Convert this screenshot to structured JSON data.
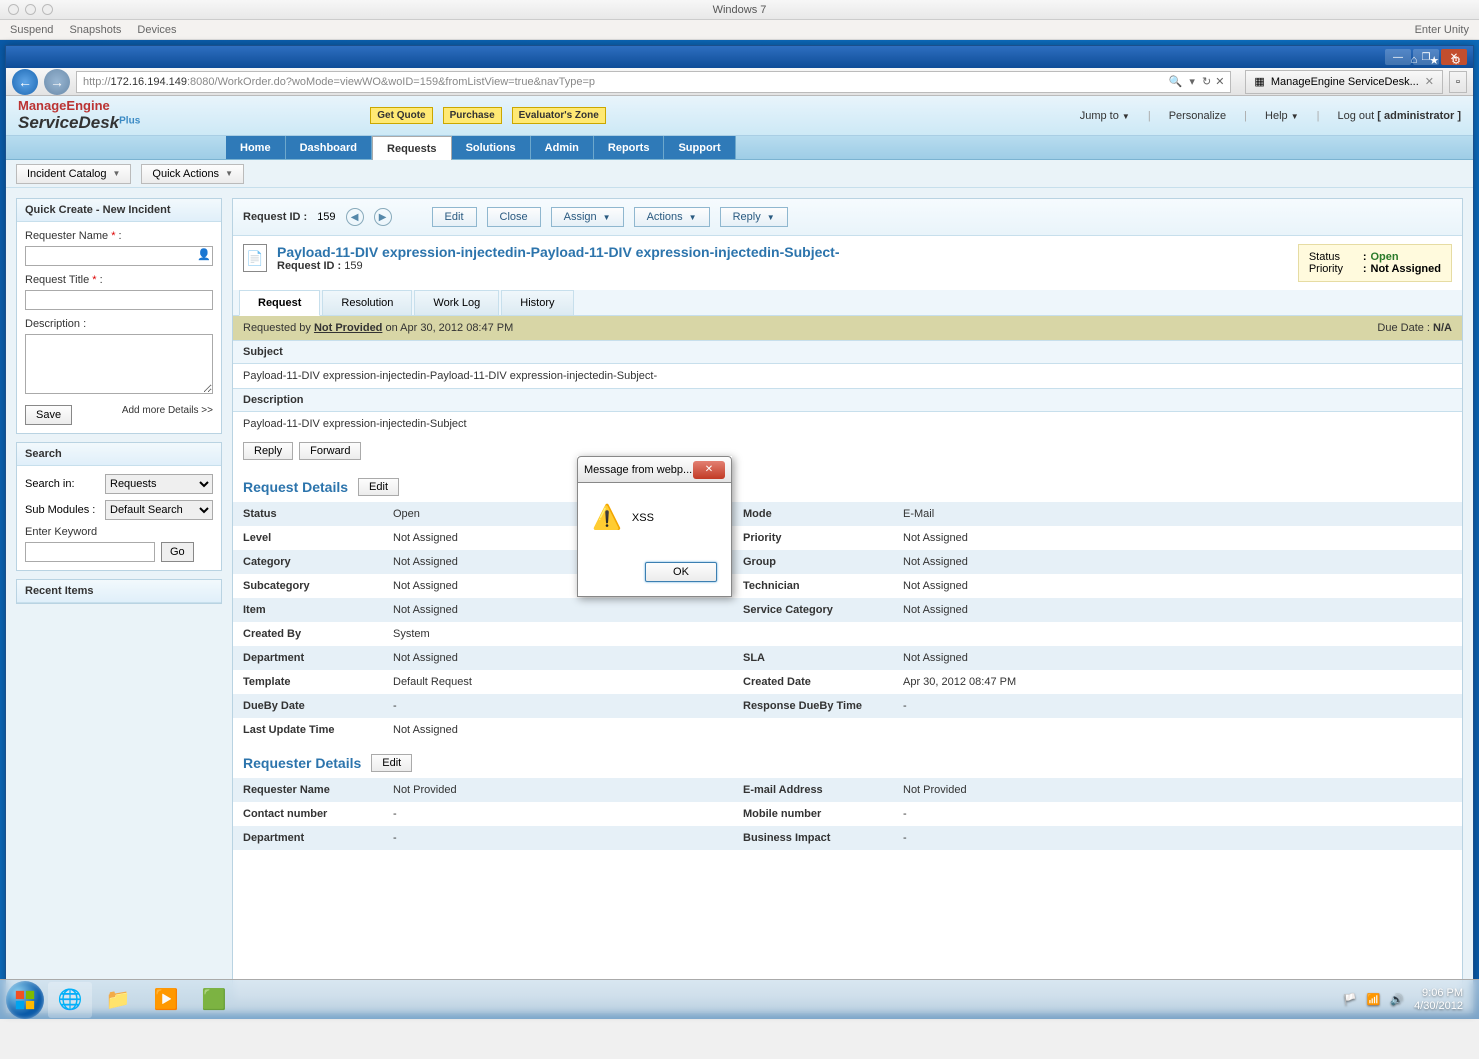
{
  "mac": {
    "title": "Windows 7",
    "menu": [
      "Suspend",
      "Snapshots",
      "Devices"
    ],
    "right": "Enter Unity"
  },
  "browser": {
    "url_prefix": "http://",
    "url_host": "172.16.194.149",
    "url_rest": ":8080/WorkOrder.do?woMode=viewWO&woID=159&fromListView=true&navType=p",
    "tab_title": "ManageEngine ServiceDesk..."
  },
  "header": {
    "logo_top": "ManageEngine",
    "logo_bottom": "ServiceDesk",
    "logo_plus": "Plus",
    "badges": [
      "Get Quote",
      "Purchase",
      "Evaluator's Zone"
    ],
    "jump": "Jump to",
    "personalize": "Personalize",
    "help": "Help",
    "logout_lbl": "Log out",
    "logout_user": "[ administrator ]"
  },
  "tabs": [
    "Home",
    "Dashboard",
    "Requests",
    "Solutions",
    "Admin",
    "Reports",
    "Support"
  ],
  "subbar": {
    "incident": "Incident Catalog",
    "quick": "Quick Actions"
  },
  "sidebar": {
    "create_title": "Quick Create - New Incident",
    "req_name": "Requester Name",
    "req_title": "Request Title",
    "desc": "Description :",
    "save": "Save",
    "add_more": "Add more Details >>",
    "search_title": "Search",
    "search_in": "Search in:",
    "search_in_val": "Requests",
    "sub_mod": "Sub Modules :",
    "sub_mod_val": "Default Search",
    "enter_kw": "Enter Keyword",
    "go": "Go",
    "recent_title": "Recent Items"
  },
  "reqbar": {
    "label": "Request ID :",
    "id": "159",
    "edit": "Edit",
    "close": "Close",
    "assign": "Assign",
    "actions": "Actions",
    "reply": "Reply"
  },
  "request": {
    "title": "Payload-11-DIV expression-injectedin-Payload-11-DIV expression-injectedin-Subject-",
    "id_label": "Request ID :",
    "id": "159",
    "status_lbl": "Status",
    "status_val": "Open",
    "priority_lbl": "Priority",
    "priority_val": "Not Assigned"
  },
  "inner_tabs": [
    "Request",
    "Resolution",
    "Work Log",
    "History"
  ],
  "meta": {
    "requested_by": "Requested by",
    "provider": "Not Provided",
    "on_date": "on Apr 30, 2012 08:47 PM",
    "due_lbl": "Due Date :",
    "due_val": "N/A"
  },
  "subject_h": "Subject",
  "subject_v": "Payload-11-DIV expression-injectedin-Payload-11-DIV expression-injectedin-Subject-",
  "desc_h": "Description",
  "desc_v": "Payload-11-DIV expression-injectedin-Subject",
  "mini": {
    "reply": "Reply",
    "forward": "Forward"
  },
  "details": {
    "title": "Request Details",
    "edit": "Edit",
    "rows": [
      {
        "l1": "Status",
        "v1": "Open",
        "l2": "Mode",
        "v2": "E-Mail"
      },
      {
        "l1": "Level",
        "v1": "Not Assigned",
        "l2": "Priority",
        "v2": "Not Assigned"
      },
      {
        "l1": "Category",
        "v1": "Not Assigned",
        "l2": "Group",
        "v2": "Not Assigned"
      },
      {
        "l1": "Subcategory",
        "v1": "Not Assigned",
        "l2": "Technician",
        "v2": "Not Assigned"
      },
      {
        "l1": "Item",
        "v1": "Not Assigned",
        "l2": "Service Category",
        "v2": "Not Assigned"
      },
      {
        "l1": "Created By",
        "v1": "System",
        "l2": "",
        "v2": ""
      },
      {
        "l1": "Department",
        "v1": "Not Assigned",
        "l2": "SLA",
        "v2": "Not Assigned"
      },
      {
        "l1": "Template",
        "v1": "Default Request",
        "l2": "Created Date",
        "v2": "Apr 30, 2012 08:47 PM"
      },
      {
        "l1": "DueBy Date",
        "v1": "-",
        "l2": "Response DueBy Time",
        "v2": "-"
      },
      {
        "l1": "Last Update Time",
        "v1": "Not Assigned",
        "l2": "",
        "v2": ""
      }
    ]
  },
  "requester": {
    "title": "Requester Details",
    "edit": "Edit",
    "rows": [
      {
        "l1": "Requester Name",
        "v1": "Not Provided",
        "l2": "E-mail Address",
        "v2": "Not Provided"
      },
      {
        "l1": "Contact number",
        "v1": "-",
        "l2": "Mobile number",
        "v2": "-"
      },
      {
        "l1": "Department",
        "v1": "-",
        "l2": "Business Impact",
        "v2": "-"
      }
    ]
  },
  "alert": {
    "title": "Message from webp...",
    "msg": "XSS",
    "ok": "OK"
  },
  "taskbar": {
    "time": "9:06 PM",
    "date": "4/30/2012"
  }
}
